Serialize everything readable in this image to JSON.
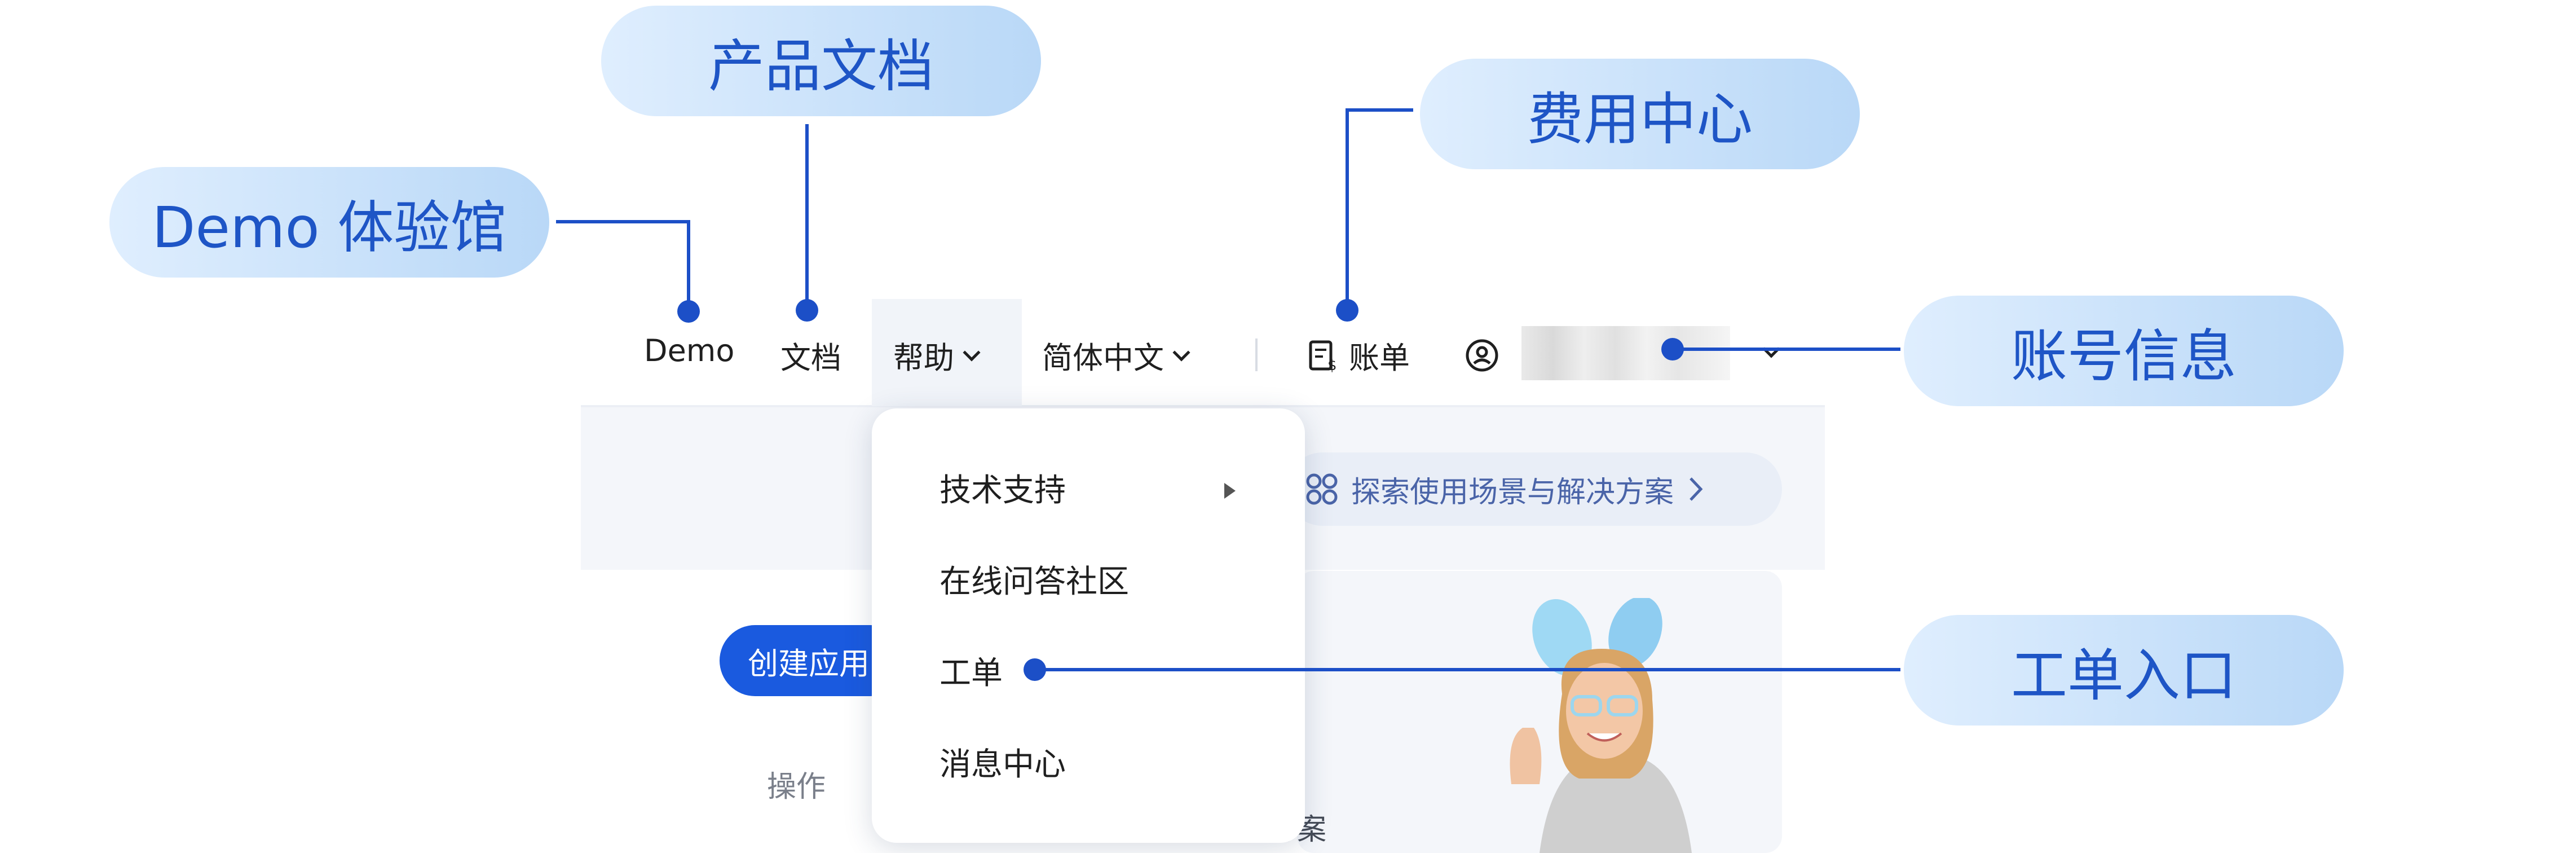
{
  "callouts": {
    "demo": "Demo 体验馆",
    "docs": "产品文档",
    "billing": "费用中心",
    "account": "账号信息",
    "ticket": "工单入口"
  },
  "nav": {
    "demo": "Demo",
    "docs": "文档",
    "help": "帮助",
    "language": "简体中文",
    "billing": "账单"
  },
  "help_menu": {
    "items": [
      "技术支持",
      "在线问答社区",
      "工单",
      "消息中心"
    ]
  },
  "background": {
    "explore": "探索使用场景与解决方案",
    "create": "创建应用",
    "operation": "操作",
    "solution": "方案"
  },
  "colors": {
    "accent": "#1c4fc7",
    "callout_text": "#1e55c6",
    "primary_button": "#1a5adf"
  },
  "icons": [
    "chevron-down-icon",
    "bill-icon",
    "user-circle-icon",
    "chevron-right-icon",
    "scenes-icon",
    "triangle-right-icon"
  ]
}
